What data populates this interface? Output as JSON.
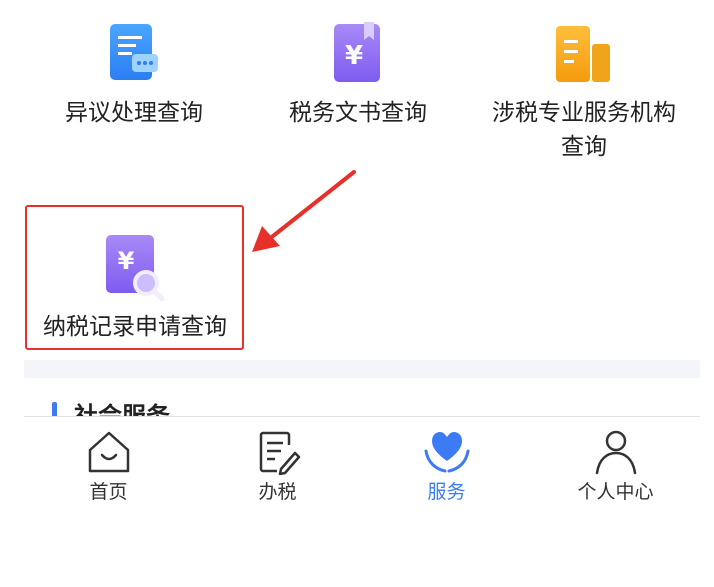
{
  "services": [
    {
      "label": "异议处理查询",
      "icon": "chat-document-icon"
    },
    {
      "label": "税务文书查询",
      "icon": "yuan-book-icon"
    },
    {
      "label_line1": "涉税专业服务机构",
      "label_line2": "查询",
      "icon": "building-icon"
    },
    {
      "label": "纳税记录申请查询",
      "icon": "yuan-search-icon"
    }
  ],
  "section_peek_text": "社会服务",
  "tabs": [
    {
      "label": "首页",
      "icon": "home-icon",
      "active": false
    },
    {
      "label": "办税",
      "icon": "edit-document-icon",
      "active": false
    },
    {
      "label": "服务",
      "icon": "heart-hands-icon",
      "active": true
    },
    {
      "label": "个人中心",
      "icon": "person-icon",
      "active": false
    }
  ],
  "colors": {
    "accent": "#3d7bf5",
    "highlight": "#e8302a"
  }
}
